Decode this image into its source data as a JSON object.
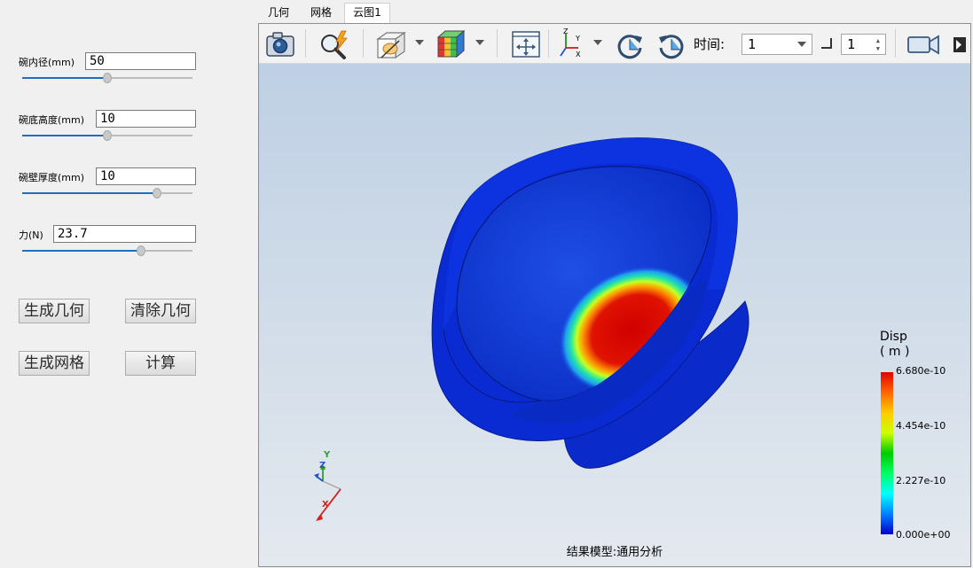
{
  "left_panel": {
    "params": [
      {
        "label": "碗内径(mm)",
        "value": "50",
        "slider_fraction": 0.5
      },
      {
        "label": "碗底高度(mm)",
        "value": "10",
        "slider_fraction": 0.5
      },
      {
        "label": "碗壁厚度(mm)",
        "value": "10",
        "slider_fraction": 0.79
      },
      {
        "label": "力(N)",
        "value": "23.7",
        "slider_fraction": 0.7
      }
    ],
    "buttons": {
      "generate_geometry": "生成几何",
      "clear_geometry": "清除几何",
      "generate_mesh": "生成网格",
      "compute": "计算"
    }
  },
  "tabs": [
    {
      "label": "几何",
      "active": false
    },
    {
      "label": "网格",
      "active": false
    },
    {
      "label": "云图1",
      "active": true
    }
  ],
  "toolbar": {
    "time_label": "时间:",
    "time_value": "1",
    "step_value": "1",
    "icons": [
      "camera-icon",
      "probe-search-icon",
      "clip-box-icon",
      "color-cube-icon",
      "fit-view-icon",
      "axes-icon",
      "rotate-cw-icon",
      "rotate-ccw-icon",
      "record-video-icon"
    ]
  },
  "legend": {
    "title": "Disp",
    "unit": "( m )",
    "ticks": [
      "6.680e-10",
      "4.454e-10",
      "2.227e-10",
      "0.000e+00"
    ],
    "colors": [
      "#0000cc",
      "#0080ff",
      "#00ffff",
      "#00ff66",
      "#00cc00",
      "#ccff00",
      "#ffcc00",
      "#ff6600",
      "#e00000"
    ]
  },
  "triad": {
    "x": "X",
    "y": "Y",
    "z": "Z"
  },
  "footer": "结果模型:通用分析",
  "colors": {
    "bowl_blue": "#0a2bd6",
    "hot_red": "#d40000",
    "slider_blue": "#1f6fbf"
  }
}
